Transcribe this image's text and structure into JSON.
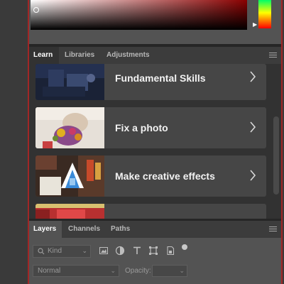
{
  "color_panel": {
    "accent_color": "#8a0000"
  },
  "learn_panel": {
    "tabs": [
      {
        "label": "Learn",
        "active": true
      },
      {
        "label": "Libraries",
        "active": false
      },
      {
        "label": "Adjustments",
        "active": false
      }
    ],
    "cards": [
      {
        "title": "Fundamental Skills",
        "icon": "chevron-right-icon"
      },
      {
        "title": "Fix a photo",
        "icon": "chevron-right-icon"
      },
      {
        "title": "Make creative effects",
        "icon": "chevron-right-icon"
      },
      {
        "title": "",
        "icon": "chevron-right-icon"
      }
    ]
  },
  "layers_panel": {
    "tabs": [
      {
        "label": "Layers",
        "active": true
      },
      {
        "label": "Channels",
        "active": false
      },
      {
        "label": "Paths",
        "active": false
      }
    ],
    "filter": {
      "label": "Kind"
    },
    "filter_icons": [
      "image-filter-icon",
      "adjustment-filter-icon",
      "type-filter-icon",
      "shape-filter-icon",
      "smart-object-filter-icon"
    ],
    "blend_mode": "Normal",
    "opacity_label": "Opacity:",
    "opacity_value": ""
  }
}
